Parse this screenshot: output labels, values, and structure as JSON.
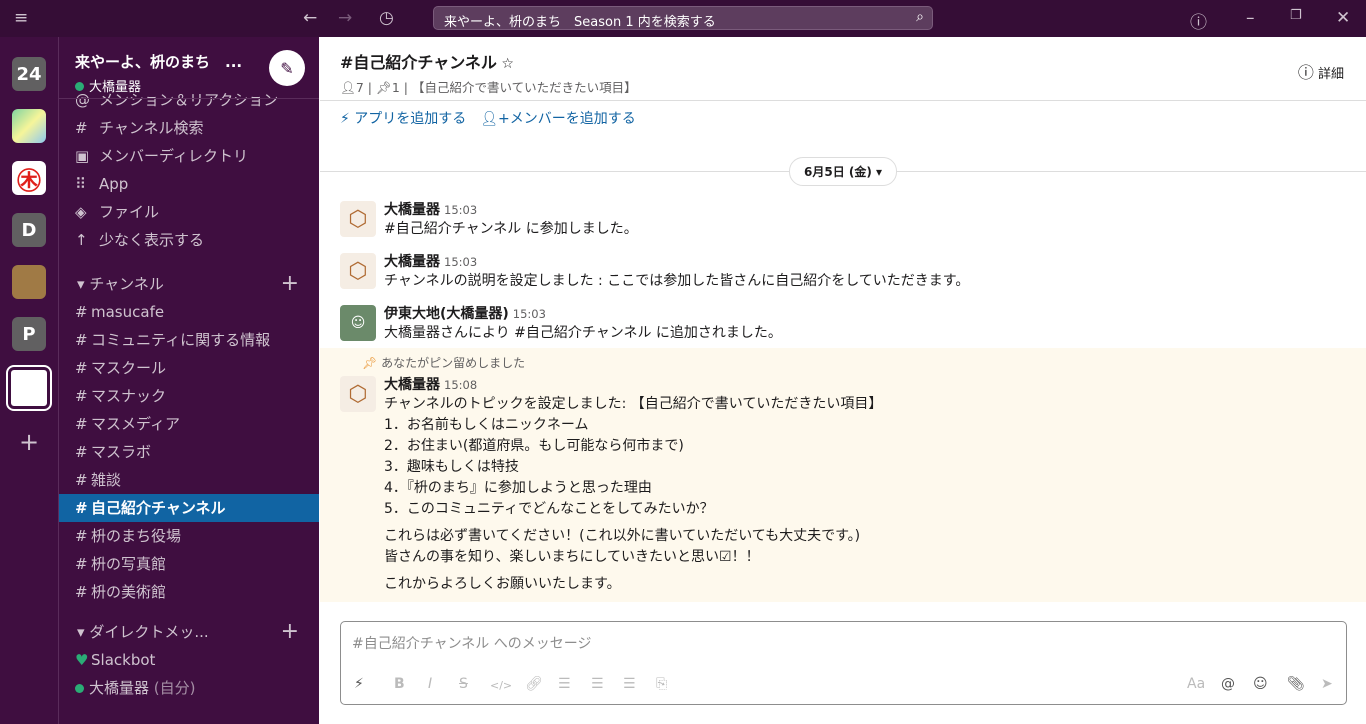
{
  "topbar": {
    "search": "来やーよ、枡のまち　Season 1 内を検索する"
  },
  "rail": {
    "workspaces": [
      "24",
      "D",
      "P"
    ]
  },
  "sidebar": {
    "workspace": "来やーよ、枡のまち　...",
    "user": "大橋量器",
    "nav": [
      {
        "icon": "at-icon",
        "label": "メンション＆リアクション"
      },
      {
        "icon": "channel-search-icon",
        "label": "チャンネル検索"
      },
      {
        "icon": "directory-icon",
        "label": "メンバーディレクトリ"
      },
      {
        "icon": "apps-icon",
        "label": "App"
      },
      {
        "icon": "files-icon",
        "label": "ファイル"
      },
      {
        "icon": "arrow-up-icon",
        "label": "少なく表示する"
      }
    ],
    "channels_title": "チャンネル",
    "channels": [
      "masucafe",
      "コミュニティに関する情報",
      "マスクール",
      "マスナック",
      "マスメディア",
      "マスラボ",
      "雑談",
      "自己紹介チャンネル",
      "枡のまち役場",
      "枡の写真館",
      "枡の美術館"
    ],
    "active_channel": "自己紹介チャンネル",
    "dm_title": "ダイレクトメッ...",
    "dms": [
      "Slackbot",
      "大橋量器"
    ],
    "dm_self": "(自分)"
  },
  "channel": {
    "name": "#自己紹介チャンネル",
    "members": "7",
    "pins": "1",
    "topic": "【自己紹介で書いていただきたい項目】",
    "details": "詳細",
    "add_app": "アプリを追加する",
    "add_member": "メンバーを追加する",
    "date": "6月5日 (金)"
  },
  "messages": [
    {
      "author": "大橋量器",
      "time": "15:03",
      "text": "#自己紹介チャンネル に参加しました。"
    },
    {
      "author": "大橋量器",
      "time": "15:03",
      "text": "チャンネルの説明を設定しました : ここでは参加した皆さんに自己紹介をしていただきます。"
    },
    {
      "author": "伊東大地(大橋量器)",
      "time": "15:03",
      "text": "大橋量器さんにより #自己紹介チャンネル に追加されました。"
    }
  ],
  "pinned_message": {
    "pin_note": "あなたがピン留めしました",
    "author": "大橋量器",
    "time": "15:08",
    "lines": [
      "チャンネルのトピックを設定しました: 【自己紹介で書いていただきたい項目】",
      "1．お名前もしくはニックネーム",
      "2．お住まい(都道府県。もし可能なら何市まで)",
      "3．趣味もしくは特技",
      "4．『枡のまち』に参加しようと思った理由",
      "5．このコミュニティでどんなことをしてみたいか？"
    ],
    "para2": [
      "これらは必ず書いてください！(これ以外に書いていただいても大丈夫です。)",
      "皆さんの事を知り、楽しいまちにしていきたいと思い☑！！"
    ],
    "para3": "これからよろしくお願いいたします。"
  },
  "composer": {
    "placeholder": "#自己紹介チャンネル へのメッセージ",
    "aa": "Aa"
  }
}
